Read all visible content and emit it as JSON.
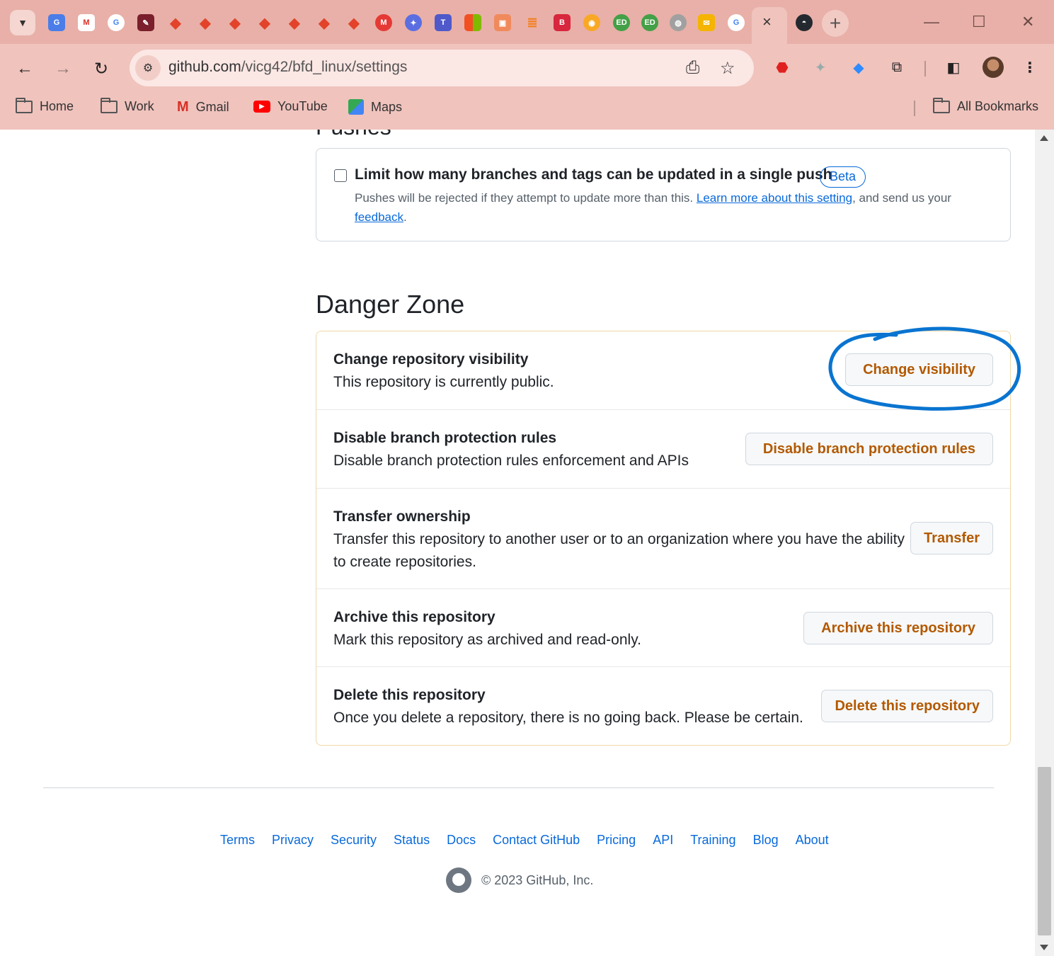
{
  "browser": {
    "url_domain": "github.com",
    "url_path": "/vicg42/bfd_linux/settings",
    "tab_close": "×",
    "new_tab": "+",
    "window_controls": {
      "minimize": "—",
      "maximize": "☐",
      "close": "✕"
    },
    "bookmarks": [
      {
        "label": "Home",
        "icon": "folder-icon"
      },
      {
        "label": "Work",
        "icon": "folder-icon"
      },
      {
        "label": "Gmail",
        "icon": "gmail-icon"
      },
      {
        "label": "YouTube",
        "icon": "youtube-icon"
      },
      {
        "label": "Maps",
        "icon": "maps-icon"
      }
    ],
    "all_bookmarks": "All Bookmarks",
    "tab_favicon_labels": {
      "ed1": "ED",
      "ed2": "ED",
      "teams": "T",
      "brave": "B"
    }
  },
  "pushes": {
    "heading_fragment": "Pushes",
    "checkbox_label": "Limit how many branches and tags can be updated in a single push",
    "badge": "Beta",
    "desc_prefix": "Pushes will be rejected if they attempt to update more than this. ",
    "learn_more": "Learn more about this setting",
    "desc_middle": ", and send us your ",
    "feedback": "feedback",
    "desc_suffix": "."
  },
  "danger_zone": {
    "title": "Danger Zone",
    "rows": [
      {
        "title": "Change repository visibility",
        "desc": "This repository is currently public.",
        "button": "Change visibility"
      },
      {
        "title": "Disable branch protection rules",
        "desc": "Disable branch protection rules enforcement and APIs",
        "button": "Disable branch protection rules"
      },
      {
        "title": "Transfer ownership",
        "desc": "Transfer this repository to another user or to an organization where you have the ability to create repositories.",
        "button": "Transfer"
      },
      {
        "title": "Archive this repository",
        "desc": "Mark this repository as archived and read-only.",
        "button": "Archive this repository"
      },
      {
        "title": "Delete this repository",
        "desc": "Once you delete a repository, there is no going back. Please be certain.",
        "button": "Delete this repository"
      }
    ]
  },
  "footer": {
    "links": [
      "Terms",
      "Privacy",
      "Security",
      "Status",
      "Docs",
      "Contact GitHub",
      "Pricing",
      "API",
      "Training",
      "Blog",
      "About"
    ],
    "copyright": "© 2023 GitHub, Inc."
  },
  "colors": {
    "link": "#0969da",
    "danger_button_text": "#b35900",
    "annotation_stroke": "#0a74d0",
    "chrome_bg": "#f0c3bd"
  }
}
